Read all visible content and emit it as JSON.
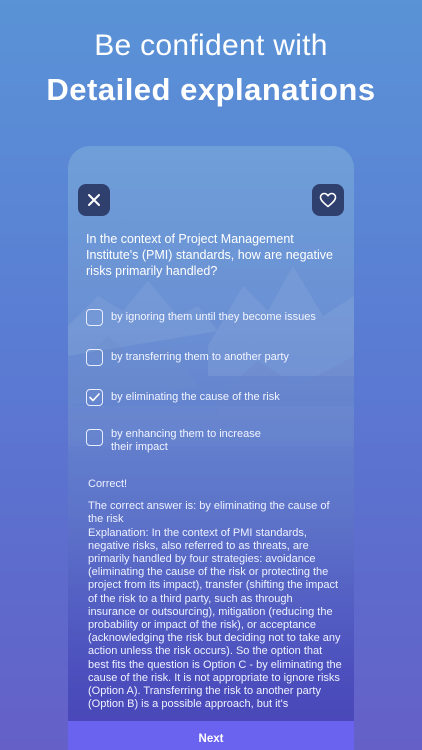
{
  "promo": {
    "line1": "Be confident with",
    "line2": "Detailed explanations"
  },
  "quiz": {
    "question": "In the context of Project Management Institute's (PMI) standards, how are negative risks primarily handled?",
    "options": [
      {
        "label": "by ignoring them until they become issues",
        "checked": false
      },
      {
        "label": "by transferring them to another party",
        "checked": false
      },
      {
        "label": "by eliminating the cause of the risk",
        "checked": true
      },
      {
        "label": "by enhancing them to increase their impact",
        "checked": false
      }
    ],
    "result": "Correct!",
    "explanation": "The correct answer is: by eliminating the cause of the risk\nExplanation: In the context of PMI standards, negative risks, also referred to as threats, are primarily handled by four strategies: avoidance (eliminating the cause of the risk or protecting the project from its impact), transfer (shifting the impact of the risk to a third party, such as through insurance or outsourcing), mitigation (reducing the probability or impact of the risk), or acceptance (acknowledging the risk but deciding not to take any action unless the risk occurs). So the option that best fits the question is Option C - by eliminating the cause of the risk. It is not appropriate to ignore risks (Option A). Transferring the risk to another party (Option B) is a possible approach, but it's",
    "next_label": "Next"
  },
  "icons": {
    "close": "close-icon",
    "favorite": "heart-icon",
    "check": "checkmark-icon"
  },
  "colors": {
    "button_bg": "#2f3f6e",
    "next_bar": "#6a63f0"
  }
}
